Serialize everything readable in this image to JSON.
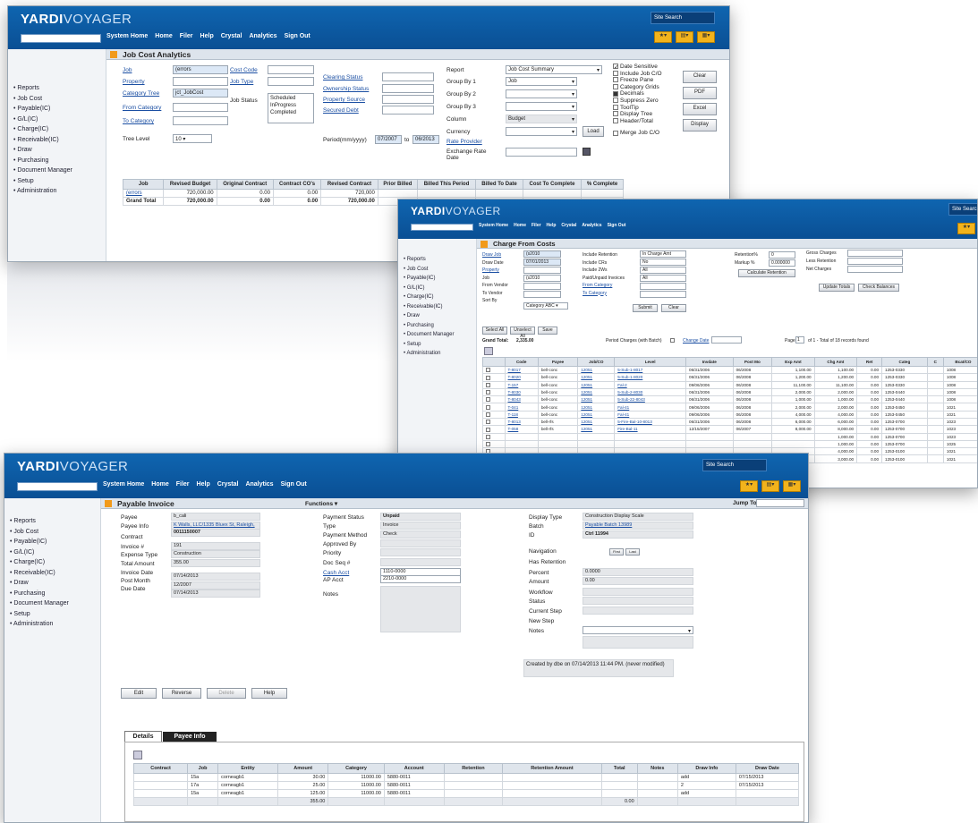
{
  "brand": {
    "bold": "YARDI",
    "light": "VOYAGER"
  },
  "menu": [
    "System Home",
    "Home",
    "Filer",
    "Help",
    "Crystal",
    "Analytics",
    "Sign Out"
  ],
  "site_search": "Site Search",
  "sidebar": [
    "Reports",
    "Job Cost",
    "Payable(IC)",
    "G/L(IC)",
    "Charge(IC)",
    "Receivable(IC)",
    "Draw",
    "Purchasing",
    "Document Manager",
    "Setup",
    "Administration"
  ],
  "w1": {
    "title": "Job Cost Analytics",
    "left_labels": [
      "Job",
      "Property",
      "Category Tree",
      "From Category",
      "To Category"
    ],
    "job_val": "(errors",
    "cat_tree_val": "jct_JobCost",
    "mid_labels": [
      "Cost Code",
      "Job Type",
      "Job Status"
    ],
    "status_opts": [
      "Scheduled",
      "InProgress",
      "Completed"
    ],
    "right_labels": [
      "Clearing Status",
      "Ownership Status",
      "Property Source",
      "Secured Debt"
    ],
    "tree_level": "Tree Level",
    "tree_val": "10",
    "period": "Period(mm/yyyy)",
    "period_from": "07/2007",
    "period_to": "06/2013",
    "to": "to",
    "report_labels": [
      "Report",
      "Group By 1",
      "Group By 2",
      "Group By 3",
      "Column",
      "Currency",
      "Rate Provider",
      "Exchange Rate Date"
    ],
    "report_val": "Job Cost Summary",
    "group1_val": "Job",
    "column_val": "Budget",
    "load": "Load",
    "checks": [
      "Date Sensitive",
      "Include Job C/O",
      "Freeze Pane",
      "Category Grids",
      "Decimals",
      "Suppress Zero",
      "ToolTip",
      "Display Tree",
      "Header/Total",
      "Merge Job C/O"
    ],
    "buttons": [
      "Clear",
      "PDF",
      "Excel",
      "Display"
    ],
    "headers": [
      "Job",
      "Revised Budget",
      "Original Contract",
      "Contract CO's",
      "Revised Contract",
      "Prior Billed",
      "Billed This Period",
      "Billed To Date",
      "Cost To Complete",
      "% Complete"
    ],
    "row": [
      "(errors",
      "720,000.00",
      "0.00",
      "0.00",
      "720,000"
    ],
    "total": [
      "Grand Total",
      "720,000.00",
      "0.00",
      "0.00",
      "720,000.00"
    ]
  },
  "w2": {
    "title": "Charge From Costs",
    "labels": [
      "Draw Job",
      "Draw Date",
      "Property",
      "Job",
      "From Vendor",
      "To Vendor",
      "Sort By"
    ],
    "vals": [
      "(s2010",
      "07/01/2013",
      "",
      "(s2010",
      "",
      "",
      "Category ABC"
    ],
    "mid_labels": [
      "Include Retention",
      "Include CRs",
      "Include 2Ws",
      "Paid/Unpaid Invoices",
      "From Category",
      "To Category"
    ],
    "mid_vals": [
      "In Charge Amt",
      "No",
      "All",
      "All"
    ],
    "right_labels": [
      "Retention%",
      "Markup %",
      "Calculate Retention"
    ],
    "right_vals": [
      "0",
      "0.000000"
    ],
    "gross": [
      "Gross Charges",
      "Less Retention",
      "Net Charges"
    ],
    "btns": [
      "Submit",
      "Clear",
      "Update Totals",
      "Check Balances"
    ],
    "small_btns": [
      "Select All",
      "Unselect All",
      "Save"
    ],
    "grand_total": "Grand Total:",
    "grand_val": "2,335.00",
    "period_label": "Period Charges (with Batch)",
    "change_date": "Change Date",
    "page_label": "Page",
    "page_val": "1",
    "page_of": "of 1 - Total of 18 records found",
    "headers": [
      "",
      "Code",
      "Payee",
      "Job/CO",
      "Level",
      "Invdate",
      "Post Mo",
      "Exp Amt",
      "Chg Amt",
      "Ret",
      "Categ",
      "C",
      "Bcat/CO"
    ],
    "rows": [
      [
        "T-8017",
        "bell-conc",
        "12051",
        "5-Sub-1-8017",
        "06/31/2006",
        "06/2008",
        "1,100.00",
        "1,100.00",
        "0.00",
        "1253-0330",
        "1008"
      ],
      [
        "T-8020",
        "bell-conc",
        "12051",
        "5-Sub-1-8020",
        "06/31/2006",
        "06/2008",
        "1,200.00",
        "1,200.00",
        "0.00",
        "1253-0330",
        "1008"
      ],
      [
        "T-157",
        "bell-conc",
        "12051",
        "Fal-2",
        "09/06/2006",
        "06/2008",
        "11,100.00",
        "11,100.00",
        "0.00",
        "1253-0330",
        "1008"
      ],
      [
        "T-8030",
        "bell-conc",
        "12051",
        "5-Sub-2-8030",
        "06/31/2006",
        "06/2008",
        "2,000.00",
        "2,000.00",
        "0.00",
        "1253-0440",
        "1008"
      ],
      [
        "T-8043",
        "bell-conc",
        "12051",
        "5-Sub-22-8043",
        "06/31/2006",
        "06/2008",
        "1,000.00",
        "1,000.00",
        "0.00",
        "1253-0440",
        "1008"
      ],
      [
        "T-041",
        "bell-conc",
        "12051",
        "Fal-41",
        "09/06/2006",
        "06/2008",
        "2,000.00",
        "2,000.00",
        "0.00",
        "1253-0450",
        "1021"
      ],
      [
        "T-118",
        "bell-conc",
        "12051",
        "Fal-41",
        "09/06/2006",
        "06/2008",
        "4,000.00",
        "4,000.00",
        "0.00",
        "1253-0450",
        "1021"
      ],
      [
        "T-8013",
        "bell-rfs",
        "12051",
        "5-Fire-Bal-10-8013",
        "06/31/2006",
        "06/2008",
        "6,000.00",
        "6,000.00",
        "0.00",
        "1253-0700",
        "1023"
      ],
      [
        "T-058",
        "bell-rfs",
        "12051",
        "Fire-Bal-11",
        "12/15/2007",
        "06/2007",
        "8,000.00",
        "8,000.00",
        "0.00",
        "1253-0700",
        "1023"
      ],
      [
        "",
        "",
        "",
        "",
        "",
        "",
        "",
        "1,000.00",
        "0.00",
        "1253-0700",
        "1023"
      ],
      [
        "",
        "",
        "",
        "",
        "",
        "",
        "",
        "1,000.00",
        "0.00",
        "1253-0700",
        "1025"
      ],
      [
        "",
        "",
        "",
        "",
        "",
        "",
        "",
        "4,000.00",
        "0.00",
        "1253-0100",
        "1021"
      ],
      [
        "",
        "",
        "",
        "",
        "",
        "",
        "",
        "3,000.00",
        "0.00",
        "1253-0100",
        "1021"
      ]
    ]
  },
  "w3": {
    "title": "Payable Invoice",
    "functions": "Functions",
    "jump": "Jump To:",
    "c1_labels": [
      "Payee",
      "Payee Info",
      "Contract",
      "Invoice #",
      "Expense Type",
      "Total Amount",
      "Invoice Date",
      "Post Month",
      "Due Date"
    ],
    "c1_vals": [
      "b_cali",
      "K Walls, LLC/1335 Bluex St, Raleigh,",
      "0011150007",
      "",
      "191",
      "Construction",
      "355.00",
      "07/14/2013",
      "12/2007",
      "07/14/2013"
    ],
    "c2_labels": [
      "Payment Status",
      "Type",
      "Payment Method",
      "Approved By",
      "Priority",
      "Doc Seq #",
      "Cash Acct",
      "AP Acct",
      "Notes"
    ],
    "c2_vals": [
      "Unpaid",
      "Invoice",
      "Check",
      "",
      "",
      "",
      "1110-0000",
      "2210-0000"
    ],
    "c3_labels": [
      "Display Type",
      "Batch",
      "ID",
      "Navigation",
      "Has Retention",
      "Percent",
      "Amount",
      "Workflow",
      "Status",
      "Current Step",
      "New Step",
      "Notes"
    ],
    "c3_vals": [
      "Construction Display Scale",
      "Payable Batch 13989",
      "Ctrl 11994",
      "0.0000",
      "0.00"
    ],
    "nav_btns": [
      "First",
      "Last"
    ],
    "created": "Created by dbe on 07/14/2013 11:44 PM. (never modified)",
    "actions": [
      "Edit",
      "Reverse",
      "Delete",
      "Help"
    ],
    "tabs": [
      "Details",
      "Payee Info"
    ],
    "headers": [
      "Contract",
      "Job",
      "Entity",
      "Amount",
      "Category",
      "Account",
      "Retention",
      "Retention Amount",
      "Total",
      "Notes",
      "Draw Info",
      "Draw Date"
    ],
    "rows": [
      [
        "",
        "15a",
        "corneagb1",
        "30.00",
        "11000.00",
        "5880-0011",
        "",
        "",
        "",
        "",
        "add",
        "07/15/2013"
      ],
      [
        "",
        "17a",
        "corneagb1",
        "25.00",
        "11000.00",
        "5880-0011",
        "",
        "",
        "",
        "",
        "2",
        "07/15/2013"
      ],
      [
        "",
        "15a",
        "corneagb1",
        "125.00",
        "11000.00",
        "5880-0011",
        "",
        "",
        "",
        "",
        "add",
        ""
      ]
    ],
    "total": "355.00",
    "total2": "0.00"
  }
}
